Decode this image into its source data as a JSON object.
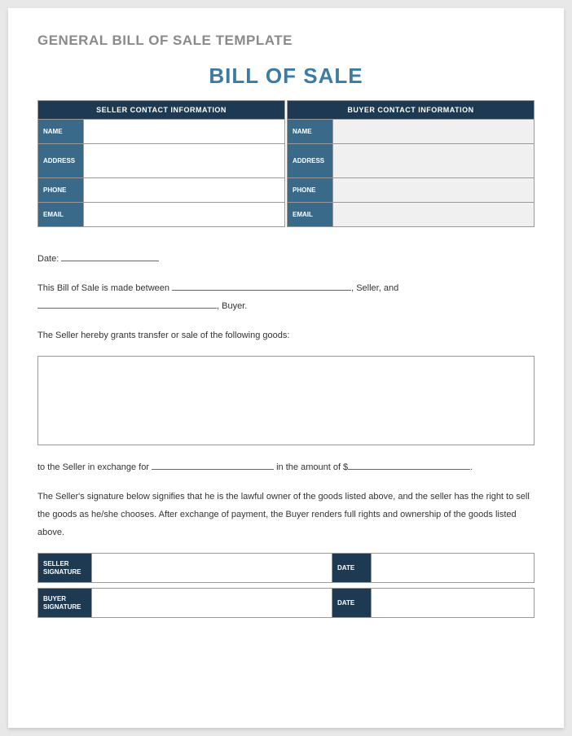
{
  "templateTitle": "GENERAL BILL OF SALE TEMPLATE",
  "mainTitle": "BILL OF SALE",
  "seller": {
    "header": "SELLER CONTACT INFORMATION",
    "labels": {
      "name": "NAME",
      "address": "ADDRESS",
      "phone": "PHONE",
      "email": "EMAIL"
    }
  },
  "buyer": {
    "header": "BUYER CONTACT INFORMATION",
    "labels": {
      "name": "NAME",
      "address": "ADDRESS",
      "phone": "PHONE",
      "email": "EMAIL"
    }
  },
  "text": {
    "dateLabel": "Date:",
    "line1a": "This Bill of Sale is made between",
    "line1b": ", Seller, and",
    "line2b": ", Buyer.",
    "line3": "The Seller hereby grants transfer or sale of the following goods:",
    "line4a": "to the Seller in exchange for",
    "line4b": "in the amount of $",
    "line4c": ".",
    "line5": "The Seller's signature below signifies that he is the lawful owner of the goods listed above, and the seller has the right to sell the goods as he/she chooses.  After exchange of payment, the Buyer renders full rights and ownership of the goods listed above."
  },
  "signatures": {
    "sellerLabel": "SELLER SIGNATURE",
    "buyerLabel": "BUYER SIGNATURE",
    "dateLabel": "DATE"
  }
}
